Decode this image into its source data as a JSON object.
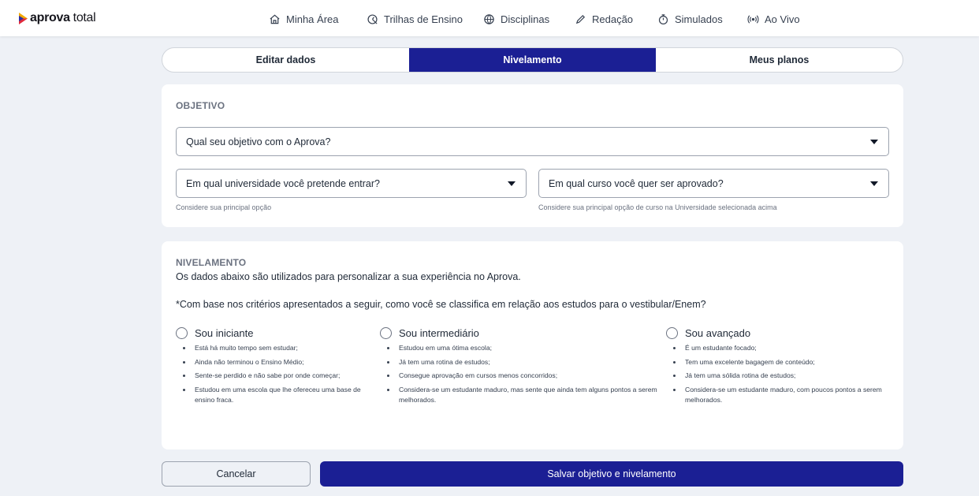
{
  "brand": {
    "part1": "aprova",
    "part2": "total"
  },
  "nav": [
    {
      "label": "Minha Área",
      "icon": "home-icon"
    },
    {
      "label": "Trilhas de Ensino",
      "icon": "path-icon"
    },
    {
      "label": "Disciplinas",
      "icon": "globe-icon"
    },
    {
      "label": "Redação",
      "icon": "pencil-icon"
    },
    {
      "label": "Simulados",
      "icon": "stopwatch-icon"
    },
    {
      "label": "Ao Vivo",
      "icon": "broadcast-icon"
    }
  ],
  "tabs": [
    {
      "label": "Editar dados",
      "active": false
    },
    {
      "label": "Nivelamento",
      "active": true
    },
    {
      "label": "Meus planos",
      "active": false
    }
  ],
  "objetivo": {
    "title": "OBJETIVO",
    "goal_select": "Qual seu objetivo com o Aprova?",
    "university_select": "Em qual universidade você pretende entrar?",
    "university_hint": "Considere sua principal opção",
    "course_select": "Em qual curso você quer ser aprovado?",
    "course_hint": "Considere sua principal opção de curso na Universidade selecionada acima"
  },
  "nivelamento": {
    "title": "NIVELAMENTO",
    "description": "Os dados abaixo são utilizados para personalizar a sua experiência no Aprova.",
    "question": "*Com base nos critérios apresentados a seguir, como você se classifica em relação aos estudos para o vestibular/Enem?",
    "options": [
      {
        "label": "Sou iniciante",
        "items": [
          "Está há muito tempo sem estudar;",
          "Ainda não terminou o Ensino Médio;",
          "Sente-se perdido e não sabe por onde começar;",
          "Estudou em uma escola que lhe ofereceu uma base de ensino fraca."
        ]
      },
      {
        "label": "Sou intermediário",
        "items": [
          "Estudou em uma ótima escola;",
          "Já tem uma rotina de estudos;",
          "Consegue aprovação em cursos menos concorridos;",
          "Considera-se um estudante maduro, mas sente que ainda tem alguns pontos a serem melhorados."
        ]
      },
      {
        "label": "Sou avançado",
        "items": [
          "É um estudante focado;",
          "Tem uma excelente bagagem de conteúdo;",
          "Já tem uma sólida rotina de estudos;",
          "Considera-se um estudante maduro, com poucos pontos a serem melhorados."
        ]
      }
    ]
  },
  "buttons": {
    "cancel": "Cancelar",
    "save": "Salvar objetivo e nivelamento"
  },
  "colors": {
    "primary": "#1b1f94",
    "background": "#eef1f6"
  }
}
